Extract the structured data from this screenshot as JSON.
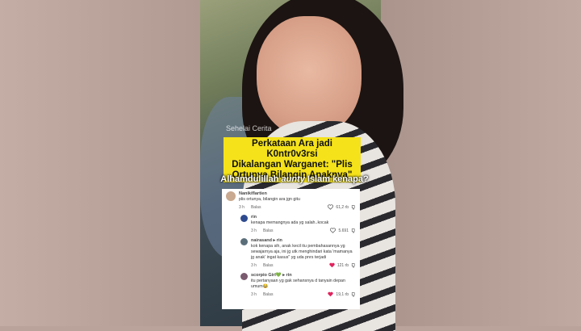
{
  "video": {
    "watermark": "Sehelai Cerita",
    "title_lines": [
      "Perkataan Ara jadi K0ntr0v3rsi",
      "Dikalangan Warganet: \"Plis",
      "Ortunya Bilangin Anaknya\""
    ],
    "caption_pre": "Alhamdulillah ",
    "caption_em": "aunty",
    "caption_post": " Islam kenapa?"
  },
  "comments": [
    {
      "user": "Nanikiflartien",
      "text": "plis ortunya, bilangin ara jgn gitu",
      "time": "3 h",
      "reply": "Balas",
      "likes": "61,2 rb",
      "liked": false,
      "avatar": "#c9a98f"
    },
    {
      "user": "rin",
      "text": "kenapa memangnya ada yg salah..kocak",
      "time": "3 h",
      "reply": "Balas",
      "likes": "5.691",
      "liked": false,
      "avatar": "#2e4a8f"
    },
    {
      "user": "nairasand ▸ rin",
      "text": "kok kenapa sih, anak kecil itu pembahasannya yg sewajarnya aja, ini jg utk menghindari kata 'mamanya jg anak' ingat kasus\" yg uda pnrs terjadi",
      "time": "3 h",
      "reply": "Balas",
      "likes": "121 rb",
      "liked": true,
      "avatar": "#5a6e7a"
    },
    {
      "user": "scorpio Girl💚 ▸ rin",
      "text": "itu pertanyaan yg gak sehansnya d tanyain depan umum😂",
      "time": "3 h",
      "reply": "Balas",
      "likes": "19,1 rb",
      "liked": true,
      "avatar": "#7a5a6e"
    }
  ],
  "colors": {
    "title_bg": "#f5e21a",
    "like_red": "#e0245e"
  }
}
